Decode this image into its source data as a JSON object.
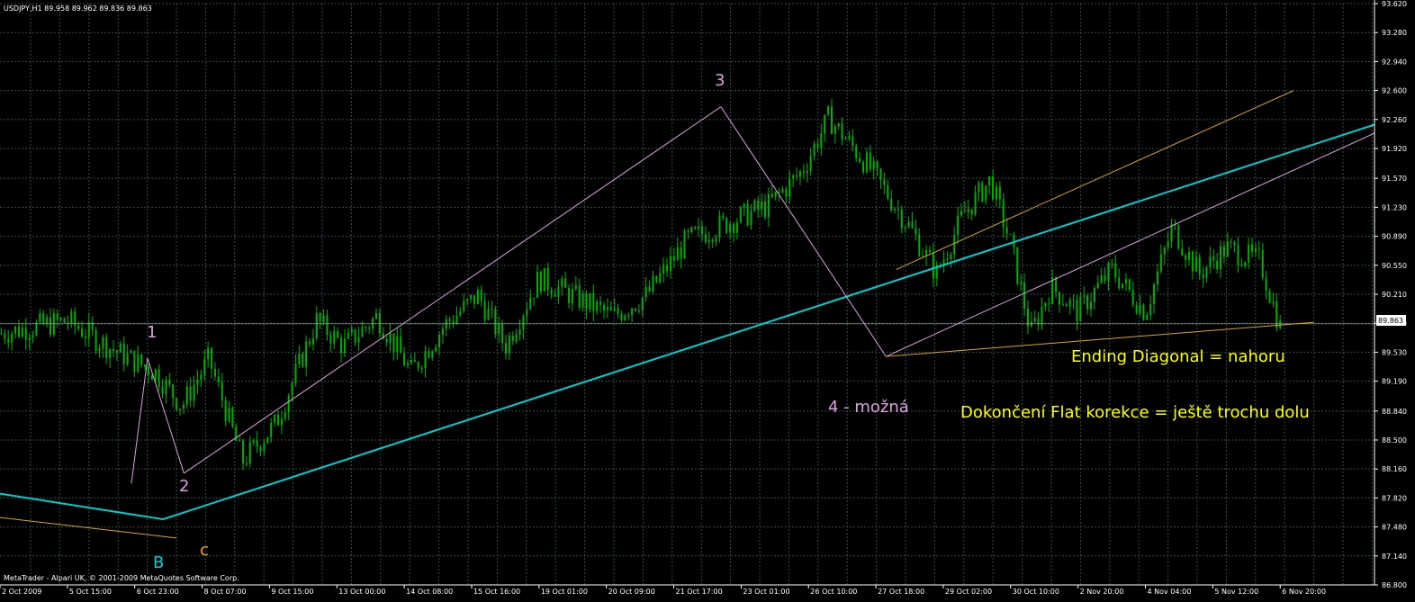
{
  "symbol_header": "USDJPY,H1  89.958 89.962 89.836 89.863",
  "copyright": "MetaTrader - Alpari UK, © 2001-2009 MetaQuotes Software Corp.",
  "current_price": "89.863",
  "colors": {
    "background": "#000000",
    "grid": "#2f4f4f",
    "candles": "#00b000",
    "wave_lines": "#dda0dd",
    "trend_cyan": "#00ced1",
    "channel_yellow": "#daa520",
    "price_line": "#c0c0c0",
    "text_white": "#ffffff",
    "text_yellow": "#ffff00",
    "label_orange": "#ffa500"
  },
  "annotations": {
    "wave1": "1",
    "wave2": "2",
    "wave3": "3",
    "wave4": "4 - možná",
    "waveB": "B",
    "waveC": "c",
    "note1": "Ending  Diagonal = nahoru",
    "note2": "Dokončení Flat korekce = ještě trochu dolu"
  },
  "chart_data": {
    "type": "candlestick",
    "symbol": "USDJPY",
    "timeframe": "H1",
    "ohlc_last": {
      "open": 89.958,
      "high": 89.962,
      "low": 89.836,
      "close": 89.863
    },
    "y_ticks": [
      "93.620",
      "93.280",
      "92.940",
      "92.600",
      "92.260",
      "91.920",
      "91.570",
      "91.230",
      "90.890",
      "90.550",
      "90.210",
      "89.870",
      "89.530",
      "89.190",
      "88.840",
      "88.500",
      "88.160",
      "87.820",
      "87.480",
      "87.140",
      "86.800"
    ],
    "ylim": [
      86.8,
      93.62
    ],
    "x_ticks": [
      "2 Oct 2009",
      "5 Oct 15:00",
      "6 Oct 23:00",
      "8 Oct 07:00",
      "9 Oct 15:00",
      "13 Oct 00:00",
      "14 Oct 08:00",
      "15 Oct 16:00",
      "19 Oct 01:00",
      "20 Oct 09:00",
      "21 Oct 17:00",
      "23 Oct 01:00",
      "26 Oct 10:00",
      "27 Oct 18:00",
      "29 Oct 02:00",
      "30 Oct 10:00",
      "2 Nov 20:00",
      "4 Nov 04:00",
      "5 Nov 12:00",
      "6 Nov 20:00"
    ],
    "price_path": [
      [
        0,
        89.75
      ],
      [
        1.0,
        89.9
      ],
      [
        1.7,
        89.55
      ],
      [
        2.3,
        89.3
      ],
      [
        2.7,
        88.9
      ],
      [
        3.1,
        89.45
      ],
      [
        3.6,
        88.25
      ],
      [
        4.1,
        88.7
      ],
      [
        4.7,
        89.9
      ],
      [
        5.1,
        89.6
      ],
      [
        5.6,
        89.95
      ],
      [
        6.1,
        89.3
      ],
      [
        6.6,
        89.85
      ],
      [
        7.1,
        90.2
      ],
      [
        7.5,
        89.6
      ],
      [
        8.0,
        90.4
      ],
      [
        8.6,
        90.15
      ],
      [
        9.1,
        89.95
      ],
      [
        9.6,
        90.2
      ],
      [
        10.2,
        90.85
      ],
      [
        10.8,
        91.05
      ],
      [
        11.4,
        91.25
      ],
      [
        11.9,
        91.65
      ],
      [
        12.3,
        92.28
      ],
      [
        12.9,
        91.7
      ],
      [
        13.5,
        91.0
      ],
      [
        13.9,
        90.45
      ],
      [
        14.3,
        91.15
      ],
      [
        14.7,
        91.55
      ],
      [
        15.0,
        90.8
      ],
      [
        15.3,
        89.75
      ],
      [
        15.6,
        90.3
      ],
      [
        16.0,
        90.0
      ],
      [
        16.5,
        90.5
      ],
      [
        17.0,
        90.0
      ],
      [
        17.4,
        91.0
      ],
      [
        17.8,
        90.45
      ],
      [
        18.2,
        90.75
      ],
      [
        18.7,
        90.6
      ],
      [
        19.0,
        89.82
      ]
    ],
    "series": [
      {
        "name": "1",
        "style": "annotation",
        "points": [
          [
            2.55,
            88.01
          ],
          [
            3.55,
            89.46
          ]
        ]
      },
      {
        "name": "2",
        "style": "annotation",
        "points": [
          [
            3.55,
            88.11
          ]
        ]
      },
      {
        "name": "3",
        "style": "annotation",
        "points": [
          [
            12.35,
            92.41
          ]
        ]
      },
      {
        "name": "4 - možná",
        "style": "annotation",
        "points": [
          [
            15.3,
            89.49
          ]
        ]
      },
      {
        "name": "B",
        "style": "annotation",
        "points": [
          [
            2.85,
            87.57
          ]
        ]
      },
      {
        "name": "c",
        "style": "annotation",
        "points": [
          [
            3.55,
            87.33
          ]
        ]
      }
    ]
  }
}
